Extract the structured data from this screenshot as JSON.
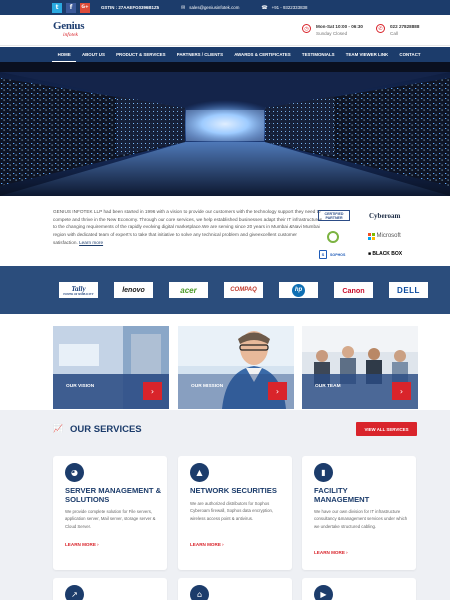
{
  "topbar": {
    "social": [
      "t",
      "f",
      "G+"
    ],
    "gstin": "GSTIN : 27AAEFG0396B1Z5",
    "email": "sales@geniusinfotek.com",
    "phone": "+91 - 9322333838"
  },
  "header": {
    "logo_main": "Genius",
    "logo_sub": "infotek",
    "hours_title": "Mon-Sat 10:00 - 06:30",
    "hours_sub": "Sunday Closed",
    "call_number": "022 27828888",
    "call_sub": "Call"
  },
  "nav": {
    "items": [
      "HOME",
      "ABOUT US",
      "PRODUCT & SERVICES",
      "PARTNERS / CLIENTS",
      "AWARDS & CERTIFICATES",
      "TESTIMONIALS",
      "TEAM VIEWER LINK",
      "CONTACT"
    ]
  },
  "about": {
    "text": "GENIUS INFOTEK LLP had been started in 1996 with a vision to provide our customers with the technology support they need to compete and thrive in the New Economy. Through our core services, we help established businesses adapt their IT infrastructures to the changing requirements of the rapidly evolving digital marketplace.We are serving since 20 years in Mumbai &Navi Mumbai region with dedicated team of expert's to take that initiative to solve any technical problem and giveexcellent customer satisfaction.",
    "link": "Learn more"
  },
  "certs": {
    "certified_partner": "CERTIFIED PARTNER",
    "cyberoam": "Cyberoam",
    "microsoft": "Microsoft",
    "sophos": "SOPHOS",
    "blackbox": "BLACK BOX"
  },
  "brands": [
    "Tally",
    "lenovo",
    "acer",
    "COMPAQ",
    "hp",
    "Canon",
    "DELL"
  ],
  "tally_tagline": "POWER OF SIMPLICITY",
  "cards": [
    {
      "label": "OUR VISION"
    },
    {
      "label": "OUR MISSION"
    },
    {
      "label": "OUR TEAM"
    }
  ],
  "services": {
    "title": "OUR SERVICES",
    "view_all": "VIEW ALL SERVICES",
    "items": [
      {
        "title": "SERVER MANAGEMENT & SOLUTIONS",
        "desc": "We provide complete solution for File servers, application server, Mail server, storage server & Cloud Server.",
        "more": "LEARN MORE"
      },
      {
        "title": "NETWORK SECURITIES",
        "desc": "We are authorized distributors for Sophos Cyberoam firewall, Sophos data encryption, wireless access point & antivirus.",
        "more": "LEARN MORE"
      },
      {
        "title": "FACILITY MANAGEMENT",
        "desc": "We have our own division for IT infrastructure consultancy &management services under which we undertake structured cabling.",
        "more": "LEARN MORE"
      }
    ]
  },
  "colors": {
    "navy": "#1c3c6b",
    "red": "#d9242b",
    "band": "#2b4d7c"
  }
}
